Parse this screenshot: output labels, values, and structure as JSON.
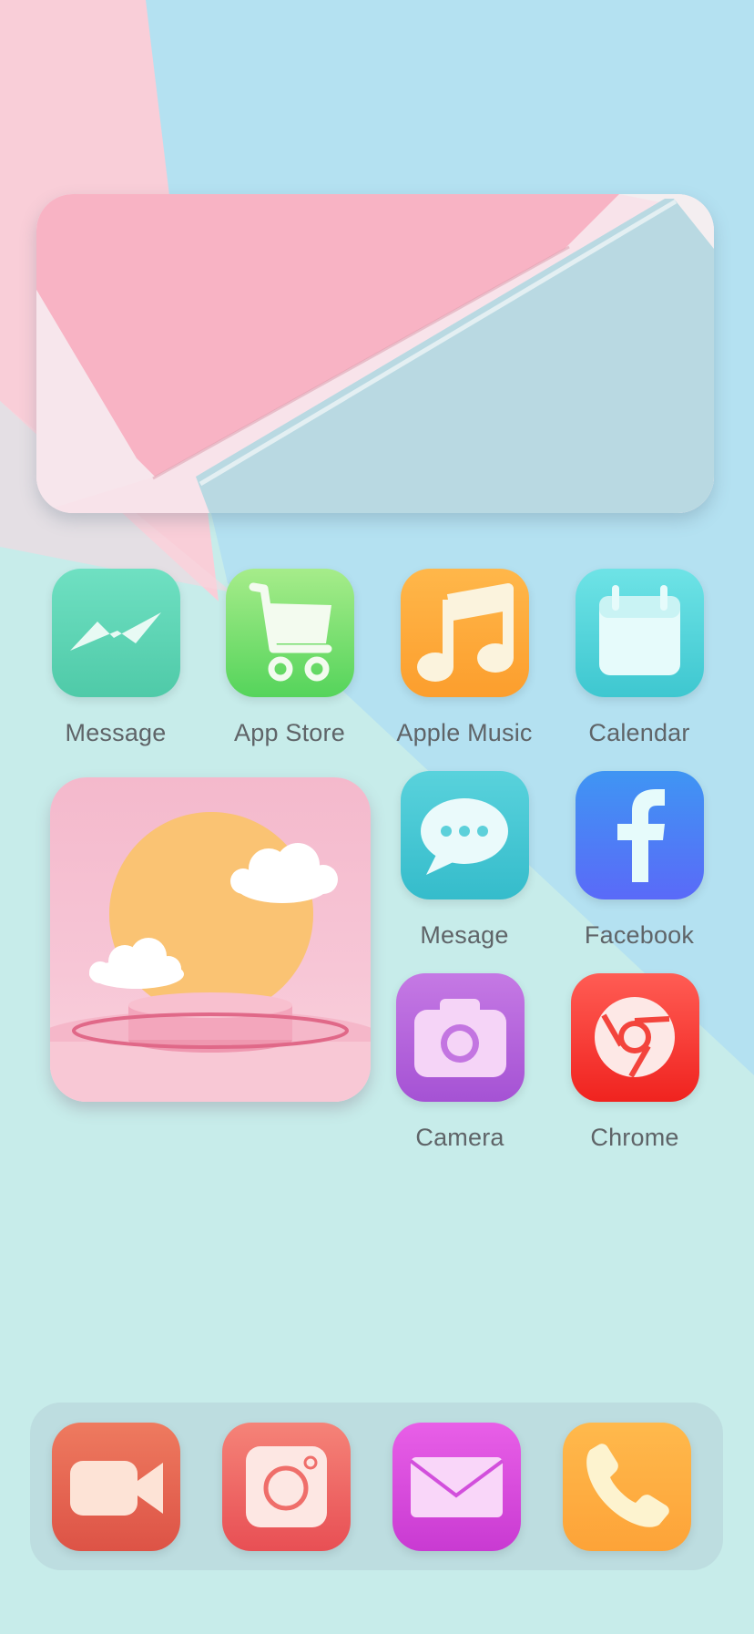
{
  "home_screen": {
    "row1": [
      {
        "label": "Message",
        "icon": "messenger-bolt-icon",
        "color": "#5ed6b8"
      },
      {
        "label": "App Store",
        "icon": "shopping-cart-icon",
        "color": "#6bd86e"
      },
      {
        "label": "Apple Music",
        "icon": "music-note-icon",
        "color": "#ffa83c"
      },
      {
        "label": "Calendar",
        "icon": "calendar-icon",
        "color": "#55d3d8"
      }
    ],
    "row2": [
      {
        "label": "Mesage",
        "icon": "chat-bubble-icon",
        "color": "#46c4d2"
      },
      {
        "label": "Facebook",
        "icon": "facebook-f-icon",
        "color": "#5575f5"
      }
    ],
    "row3": [
      {
        "label": "Camera",
        "icon": "camera-icon",
        "color": "#b65fdc"
      },
      {
        "label": "Chrome",
        "icon": "chrome-icon",
        "color": "#f8342f"
      }
    ]
  },
  "dock": [
    {
      "name": "FaceTime",
      "icon": "video-camera-icon",
      "color": "#e8604d"
    },
    {
      "name": "Instagram",
      "icon": "instagram-icon",
      "color": "#ef5e5e"
    },
    {
      "name": "Mail",
      "icon": "mail-envelope-icon",
      "color": "#d94be0"
    },
    {
      "name": "Phone",
      "icon": "phone-handset-icon",
      "color": "#ffae3a"
    }
  ],
  "colors": {
    "wallpaper_blue": "#b5e2f2",
    "wallpaper_pink": "#f9cdd7",
    "wallpaper_mint": "#c6ecea",
    "label_text": "#5f6468"
  }
}
